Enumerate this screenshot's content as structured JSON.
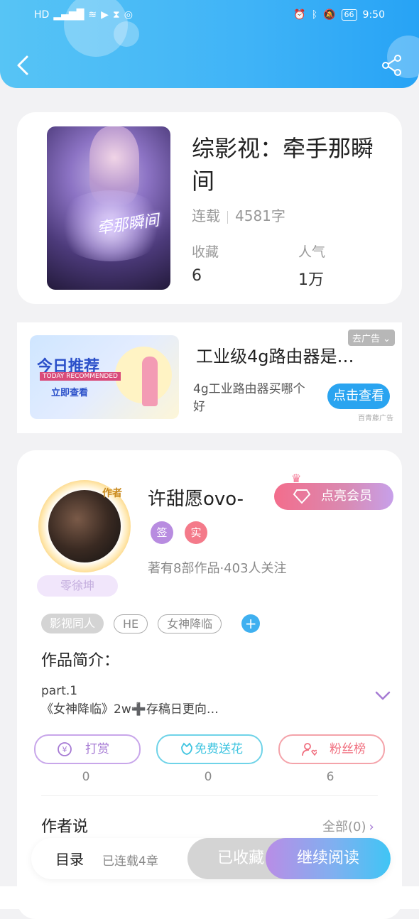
{
  "status_bar": {
    "network": "4G",
    "hd": "HD",
    "battery": "66",
    "time": "9:50"
  },
  "colors": {
    "header_blue": "#3fb3f7",
    "accent_blue": "#2aa4f0",
    "vip_pink": "#f36d8c",
    "tip_purple": "#a67ad4",
    "flower_cyan": "#3ec4e0",
    "fans_pink": "#f06e7e"
  },
  "book": {
    "title": "综影视：牵手那瞬间",
    "status": "连载",
    "word_count": "4581字",
    "favorites_label": "收藏",
    "favorites_value": "6",
    "popularity_label": "人气",
    "popularity_value": "1万",
    "cover_text": "牵那瞬间"
  },
  "ad": {
    "banner_title": "今日推荐",
    "banner_subtitle": "TODAY RECOMMENDED",
    "banner_button": "立即查看",
    "tag": "去广告",
    "title": "工业级4g路由器是…",
    "description": "4g工业路由器买哪个好",
    "button": "点击查看",
    "source": "百青藤广告"
  },
  "author": {
    "badge": "作者",
    "avatar_label": "零徐坤",
    "name": "许甜愿ovo-",
    "vip_button": "点亮会员",
    "badge_sign": "签",
    "badge_real": "实",
    "stats": "著有8部作品·403人关注",
    "tags": [
      "影视同人",
      "HE",
      "女神降临"
    ],
    "intro_title": "作品简介：",
    "intro_line1": "part.1",
    "intro_line2": "《女神降临》2w➕存稿日更向…",
    "tip_label": "打赏",
    "tip_count": "0",
    "flower_label": "免费送花",
    "flower_count": "0",
    "fans_label": "粉丝榜",
    "fans_count": "6",
    "says_title": "作者说",
    "says_all": "全部(0)"
  },
  "bottom": {
    "toc": "目录",
    "toc_sub": "已连载4章",
    "collected": "已收藏",
    "continue": "继续阅读"
  }
}
